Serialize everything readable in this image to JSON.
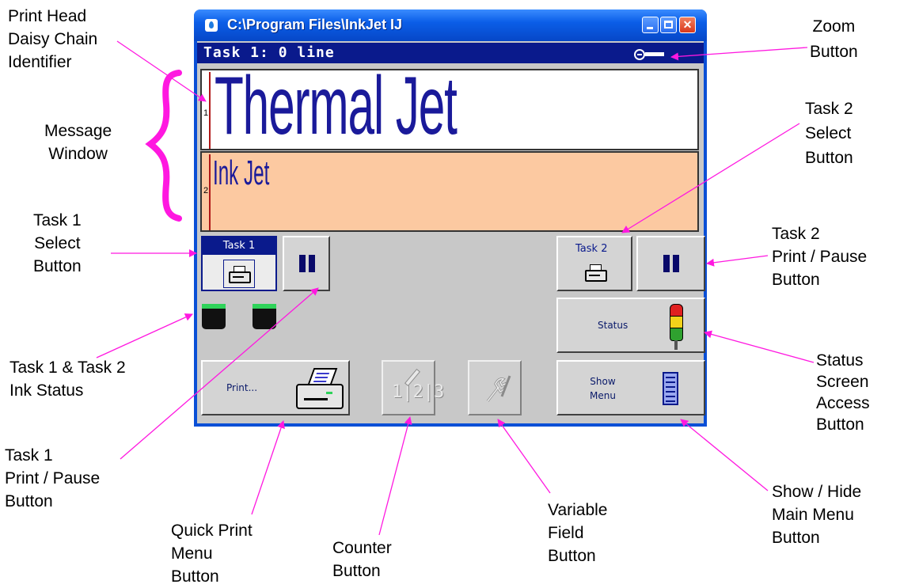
{
  "window": {
    "title": "C:\\Program Files\\InkJet  IJ",
    "task_title": "Task 1: 0 line",
    "line1": {
      "number": "1",
      "text": "Thermal Jet"
    },
    "line2": {
      "number": "2",
      "text": "Ink Jet"
    },
    "buttons": {
      "task1": "Task 1",
      "task2": "Task 2",
      "status": "Status",
      "print": "Print...",
      "show_menu_1": "Show",
      "show_menu_2": "Menu",
      "counter_glyph": "1|2|3"
    }
  },
  "annotations": {
    "print_head": [
      "Print Head",
      "Daisy Chain",
      "Identifier"
    ],
    "message_window": [
      "Message",
      "Window"
    ],
    "task1_select": [
      "Task 1",
      "Select",
      "Button"
    ],
    "ink_status": [
      "Task 1 & Task 2",
      "Ink Status"
    ],
    "task1_print_pause": [
      "Task 1",
      "Print / Pause",
      "Button"
    ],
    "quick_print": [
      "Quick Print",
      "Menu",
      "Button"
    ],
    "counter": [
      "Counter",
      "Button"
    ],
    "variable_field": [
      "Variable",
      "Field",
      "Button"
    ],
    "show_hide_menu": [
      "Show / Hide",
      "Main Menu",
      "Button"
    ],
    "status_screen": [
      "Status",
      "Screen",
      "Access",
      "Button"
    ],
    "task2_print_pause": [
      "Task 2",
      "Print / Pause",
      "Button"
    ],
    "task2_select": [
      "Task 2",
      "Select",
      "Button"
    ],
    "zoom": [
      "Zoom",
      "Button"
    ]
  },
  "colors": {
    "annotation_arrow": "#ff18e0",
    "message_line2_bg": "#fcc9a1",
    "message_text": "#1a1a9a",
    "title_bar": "#0b5ee8",
    "ink_ok": "#2fd35a"
  }
}
